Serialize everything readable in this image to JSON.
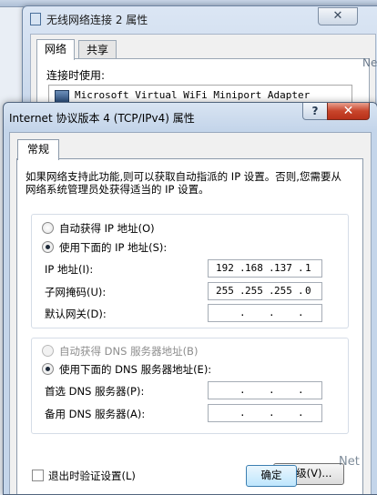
{
  "back_window": {
    "top_strip_left": "",
    "top_strip_mid": "",
    "top_strip_right": "",
    "title": "无线网络连接 2 属性",
    "close_glyph": "✕",
    "tabs": [
      "网络",
      "共享"
    ],
    "connect_using_label": "连接时使用:",
    "adapter_name": "Microsoft Virtual WiFi Miniport Adapter"
  },
  "dialog": {
    "title": "Internet 协议版本 4 (TCP/IPv4) 属性",
    "help_glyph": "?",
    "close_glyph": "✕",
    "tab": "常规",
    "description": "如果网络支持此功能,则可以获取自动指派的 IP 设置。否则,您需要从网络系统管理员处获得适当的 IP 设置。",
    "ip_auto_label": "自动获得 IP 地址(O)",
    "ip_manual_label": "使用下面的 IP 地址(S):",
    "ip_address_label": "IP 地址(I):",
    "ip_address": [
      "192",
      "168",
      "137",
      "1"
    ],
    "subnet_label": "子网掩码(U):",
    "subnet": [
      "255",
      "255",
      "255",
      "0"
    ],
    "gateway_label": "默认网关(D):",
    "gateway": [
      "",
      "",
      "",
      ""
    ],
    "dns_auto_label": "自动获得 DNS 服务器地址(B)",
    "dns_manual_label": "使用下面的 DNS 服务器地址(E):",
    "dns_pref_label": "首选 DNS 服务器(P):",
    "dns_pref": [
      "",
      "",
      "",
      ""
    ],
    "dns_alt_label": "备用 DNS 服务器(A):",
    "dns_alt": [
      "",
      "",
      "",
      ""
    ],
    "validate_label": "退出时验证设置(L)",
    "advanced_button": "高级(V)...",
    "ok_button": "确定",
    "selected_ip_mode": "manual",
    "selected_dns_mode": "manual"
  },
  "watermarks": {
    "bottom_text": "",
    "bottom_url": "",
    "net_text": "Net",
    "back_text": "Ne"
  },
  "colors": {
    "title_gradient_top": "#d8e4f2",
    "title_gradient_bottom": "#c4d5ea",
    "close_red": "#c8452b",
    "ok_border": "#3c7fb1"
  }
}
